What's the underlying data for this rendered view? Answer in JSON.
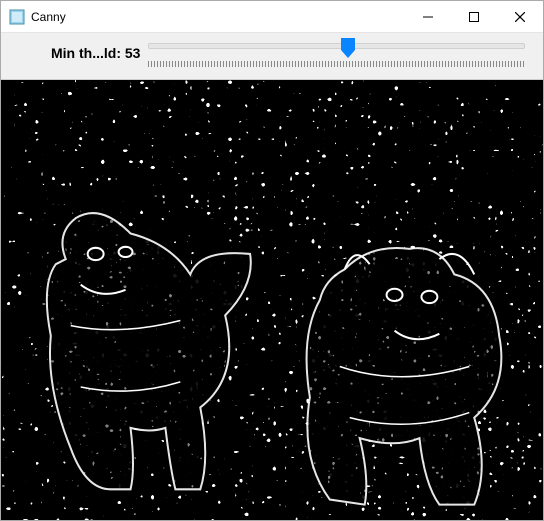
{
  "window": {
    "title": "Canny"
  },
  "toolbar": {
    "slider_label_prefix": "Min th...ld: ",
    "slider_value": 53,
    "slider_min": 0,
    "slider_max": 100,
    "slider_percent": 53
  },
  "icons": {
    "app": "app-icon",
    "minimize": "minimize-icon",
    "maximize": "maximize-icon",
    "close": "close-icon"
  },
  "colors": {
    "thumb": "#0a84ff",
    "toolbar_bg": "#f0f0f0"
  },
  "content": {
    "description": "Canny edge detection output showing two dogs"
  }
}
